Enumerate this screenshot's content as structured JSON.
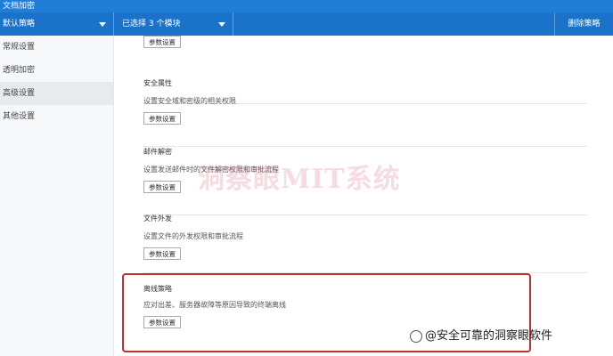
{
  "window": {
    "title": "文档加密"
  },
  "toolbar": {
    "strategy_select": "默认策略",
    "batch_select": "已选择 3 个模块",
    "right_button": "删除策略"
  },
  "sidebar": {
    "items": [
      {
        "label": "常规设置",
        "active": false
      },
      {
        "label": "透明加密",
        "active": false
      },
      {
        "label": "高级设置",
        "active": true
      },
      {
        "label": "其他设置",
        "active": false
      }
    ]
  },
  "sections": [
    {
      "title": "",
      "desc": "",
      "button": "参数设置"
    },
    {
      "title": "安全属性",
      "desc": "设置安全域和密级的相关权限",
      "button": "参数设置"
    },
    {
      "title": "邮件解密",
      "desc": "设置发送邮件时的文件解密权限和审批流程",
      "button": "参数设置"
    },
    {
      "title": "文件外发",
      "desc": "设置文件的外发权限和审批流程",
      "button": "参数设置"
    },
    {
      "title": "离线策略",
      "desc": "应对出差、服务器故障等原因导致的终端离线",
      "button": "参数设置"
    }
  ],
  "watermark": {
    "text": "洞察眼MIT系统"
  },
  "source_mark": {
    "text": "@安全可靠的洞察眼软件"
  },
  "colors": {
    "titlebar": "#1f7fd8",
    "toolbar": "#1a73c9",
    "highlight": "#b8342d"
  }
}
